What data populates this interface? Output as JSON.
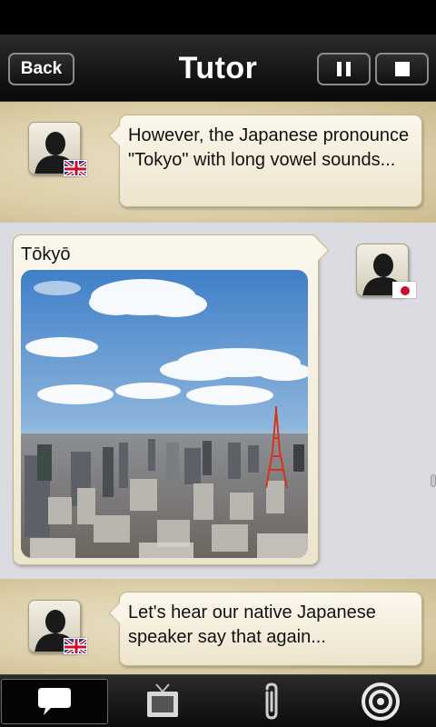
{
  "header": {
    "back_label": "Back",
    "title": "Tutor",
    "pause_icon": "pause-icon",
    "stop_icon": "stop-icon"
  },
  "messages": [
    {
      "speaker": "tutor",
      "flag": "uk-flag-icon",
      "text": "However, the Japanese pronounce \"Tokyo\" with long vowel sounds..."
    },
    {
      "speaker": "native-speaker",
      "flag": "japan-flag-icon",
      "caption": "Tōkyō",
      "image": "tokyo-skyline-photo"
    },
    {
      "speaker": "tutor",
      "flag": "uk-flag-icon",
      "text": "Let's hear our native Japanese speaker say that again..."
    }
  ],
  "bottom_tabs": [
    {
      "icon": "speech-bubble-icon",
      "selected": true
    },
    {
      "icon": "tv-icon",
      "selected": false
    },
    {
      "icon": "paperclip-icon",
      "selected": false
    },
    {
      "icon": "target-icon",
      "selected": false
    }
  ],
  "colors": {
    "chat_background": "#dcdbe2",
    "parchment": "#dccfa9",
    "bubble": "#f5efdf",
    "bar_dark": "#111111"
  }
}
